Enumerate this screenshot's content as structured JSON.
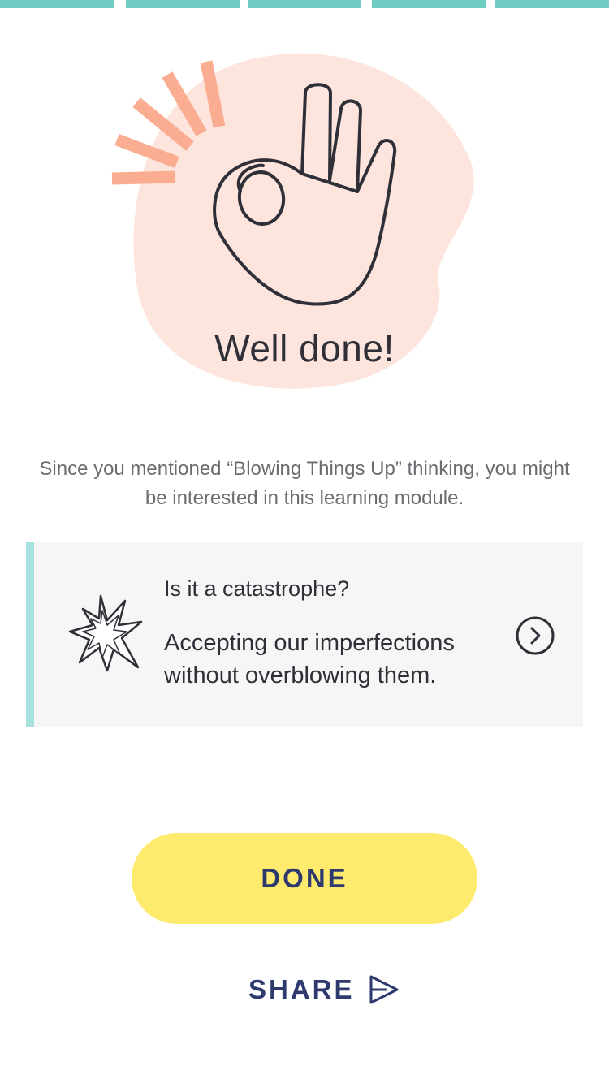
{
  "progress": {
    "segments": 5,
    "completed": 5,
    "color": "#6fcdc4"
  },
  "hero": {
    "illustration": "ok-hand-icon",
    "blob_color": "#fde4dc",
    "rays_color": "#fbad92",
    "title": "Well done!"
  },
  "message": {
    "text": "Since you mentioned “Blowing Things Up” thinking, you might be interested in this learning module."
  },
  "module_card": {
    "icon": "burst-icon",
    "title": "Is it a catastrophe?",
    "description": "Accepting our imperfections without overblowing them.",
    "action_icon": "chevron-right-circle-icon",
    "accent_color": "#a6e3de",
    "background": "#f6f6f6"
  },
  "actions": {
    "done_label": "DONE",
    "done_color": "#feea6d",
    "share_label": "SHARE",
    "share_icon": "send-icon",
    "text_color": "#2e3a6e"
  }
}
